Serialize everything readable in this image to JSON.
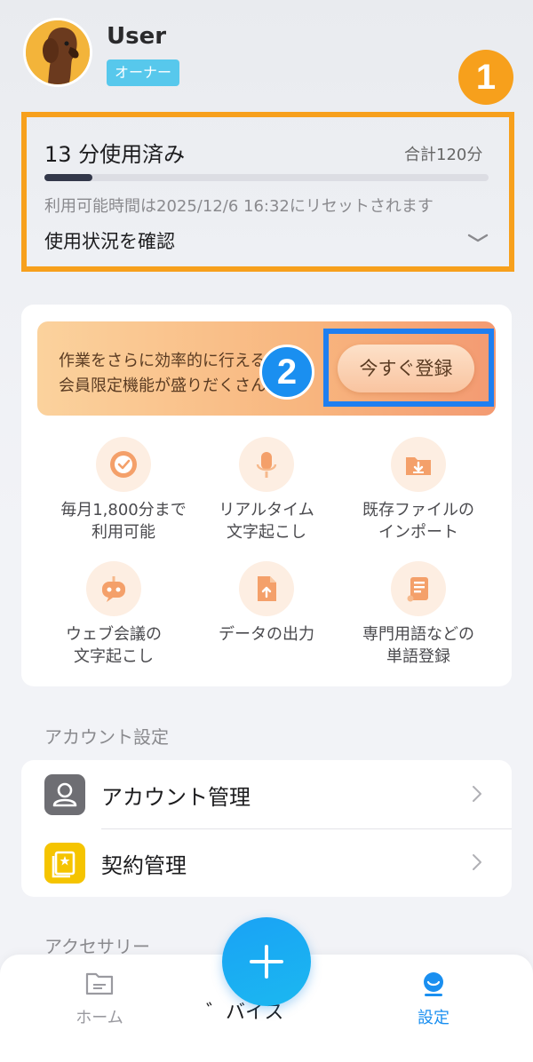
{
  "profile": {
    "name": "User",
    "role": "オーナー"
  },
  "markers": {
    "one": "1",
    "two": "2"
  },
  "usage": {
    "used_text": "13 分使用済み",
    "total_text": "合計120分",
    "progress_fraction": 0.108,
    "reset_text": "利用可能時間は2025/12/6 16:32にリセットされます",
    "check_label": "使用状況を確認"
  },
  "promo": {
    "line1": "作業をさらに効率的に行える",
    "line2": "会員限定機能が盛りだくさん",
    "register_label": "今すぐ登録"
  },
  "features": [
    {
      "line1": "毎月1,800分まで",
      "line2": "利用可能",
      "icon": "clock-icon"
    },
    {
      "line1": "リアルタイム",
      "line2": "文字起こし",
      "icon": "microphone-icon"
    },
    {
      "line1": "既存ファイルの",
      "line2": "インポート",
      "icon": "folder-import-icon"
    },
    {
      "line1": "ウェブ会議の",
      "line2": "文字起こし",
      "icon": "robot-icon"
    },
    {
      "line1": "データの出力",
      "line2": "",
      "icon": "file-export-icon"
    },
    {
      "line1": "専門用語などの",
      "line2": "単語登録",
      "icon": "scroll-icon"
    }
  ],
  "account_section": {
    "title": "アカウント設定",
    "items": [
      {
        "label": "アカウント管理",
        "icon": "person-icon"
      },
      {
        "label": "契約管理",
        "icon": "contract-icon"
      }
    ]
  },
  "accessory_section": {
    "title": "アクセサリー"
  },
  "tabbar": {
    "home": "ホーム",
    "device_partial": "゛バイス",
    "settings": "設定",
    "active_color": "#1a8ff0",
    "inactive_color": "#9a9aa0"
  }
}
